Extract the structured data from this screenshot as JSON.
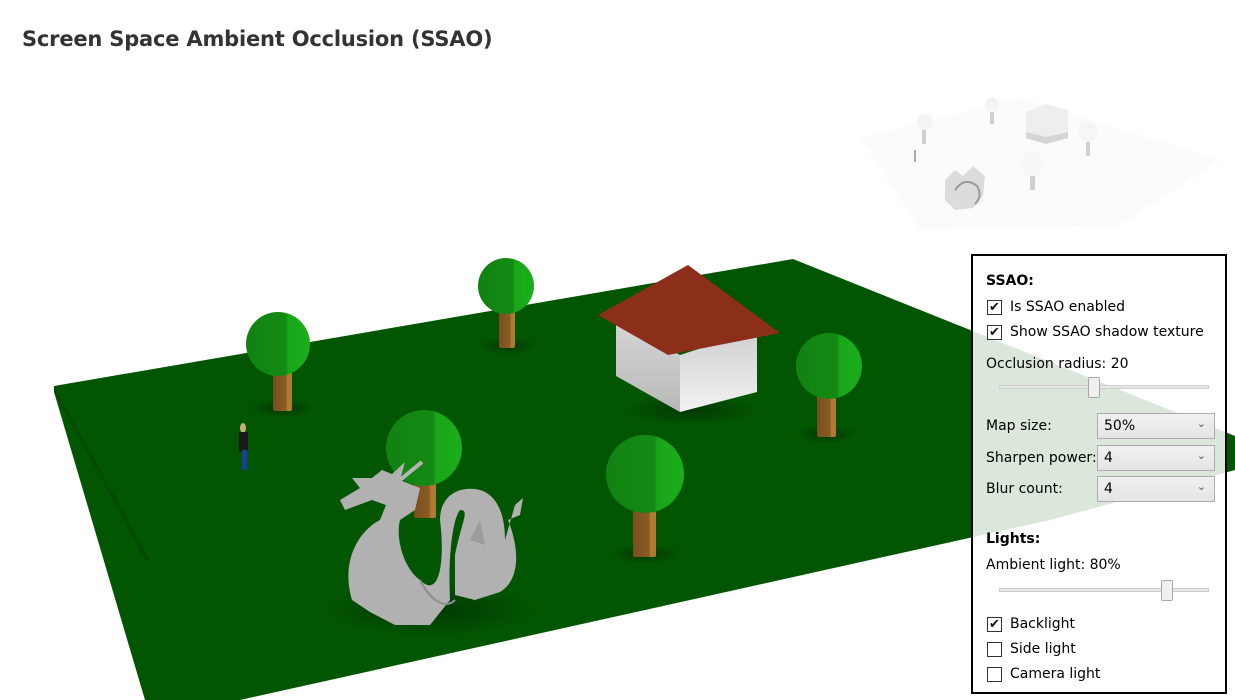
{
  "page": {
    "title": "Screen Space Ambient Occlusion (SSAO)"
  },
  "scene": {
    "ground_color": "#025602",
    "tree_crown_color": "#168c16",
    "tree_trunk_color": "#8b5a22",
    "roof_color": "#8b2e1a",
    "house_wall_color": "#d8d8d8",
    "dragon_color": "#a8a8a8",
    "objects": [
      "ground-plane",
      "house",
      "tree",
      "tree",
      "tree",
      "tree",
      "tree",
      "tree",
      "dragon",
      "person"
    ],
    "ssao_preview": "ssao-shadow-texture"
  },
  "panel": {
    "ssao_title": "SSAO:",
    "ssao_enabled": {
      "label": "Is SSAO enabled",
      "checked": true
    },
    "show_texture": {
      "label": "Show SSAO shadow texture",
      "checked": true
    },
    "occlusion_radius": {
      "label": "Occlusion radius: 20",
      "value": 20,
      "fraction": 0.45
    },
    "map_size": {
      "label": "Map size:",
      "value": "50%"
    },
    "sharpen_power": {
      "label": "Sharpen power:",
      "value": "4"
    },
    "blur_count": {
      "label": "Blur count:",
      "value": "4"
    },
    "lights_title": "Lights:",
    "ambient_light": {
      "label": "Ambient light: 80%",
      "value": 80,
      "fraction": 0.8
    },
    "backlight": {
      "label": "Backlight",
      "checked": true
    },
    "side_light": {
      "label": "Side light",
      "checked": false
    },
    "camera_light": {
      "label": "Camera light",
      "checked": false
    },
    "check_glyph": "✔",
    "chevron_glyph": "⌄"
  }
}
